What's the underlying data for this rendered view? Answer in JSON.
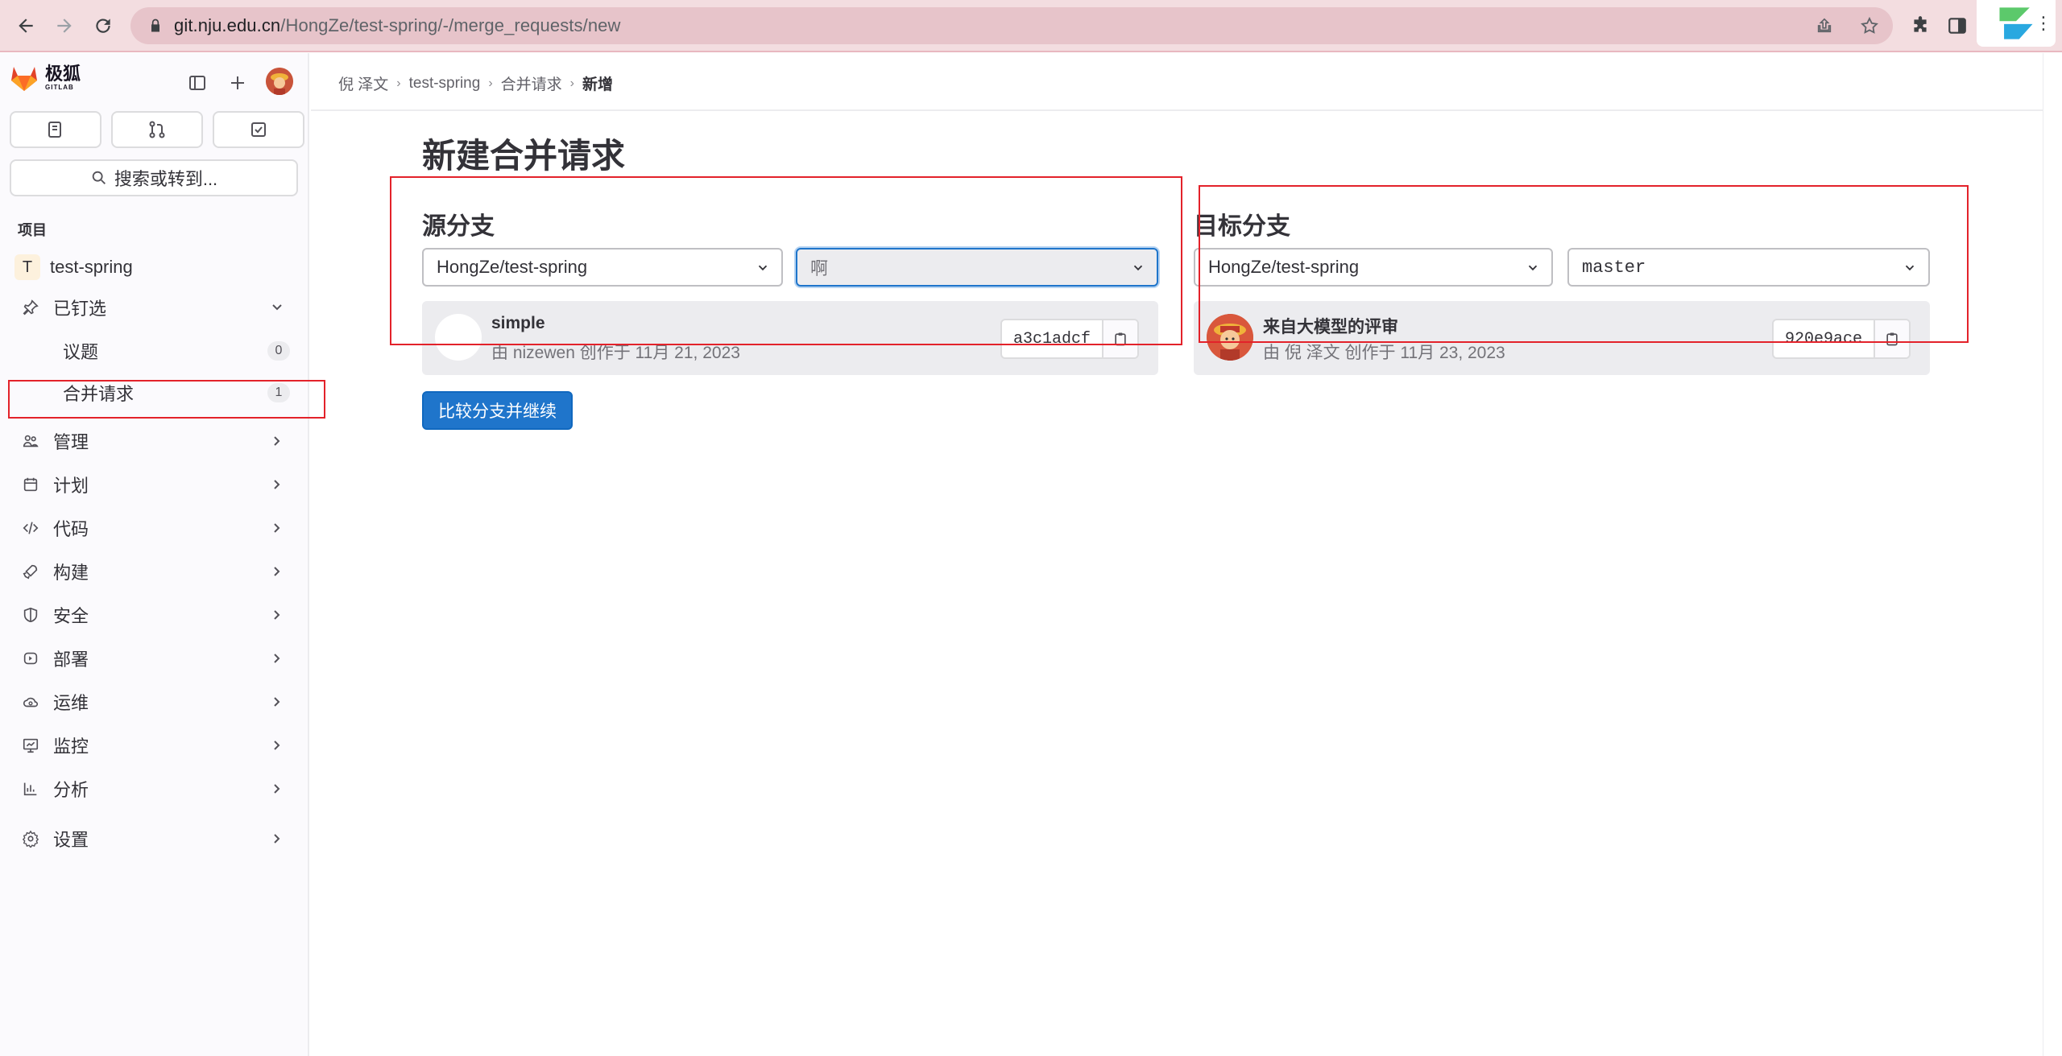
{
  "browser": {
    "url_host": "git.nju.edu.cn",
    "url_path": "/HongZe/test-spring/-/merge_requests/new"
  },
  "sidebar": {
    "logo_text": "极狐",
    "logo_subtext": "GITLAB",
    "search_placeholder": "搜索或转到...",
    "section_label": "项目",
    "project_initial": "T",
    "project_name": "test-spring",
    "pinned": {
      "label": "已钉选",
      "items": [
        {
          "label": "议题",
          "count": "0"
        },
        {
          "label": "合并请求",
          "count": "1"
        }
      ]
    },
    "nav": [
      {
        "label": "管理",
        "icon": "users-icon"
      },
      {
        "label": "计划",
        "icon": "calendar-icon"
      },
      {
        "label": "代码",
        "icon": "code-icon"
      },
      {
        "label": "构建",
        "icon": "rocket-icon"
      },
      {
        "label": "安全",
        "icon": "shield-icon"
      },
      {
        "label": "部署",
        "icon": "deploy-icon"
      },
      {
        "label": "运维",
        "icon": "cloud-gear-icon"
      },
      {
        "label": "监控",
        "icon": "monitor-icon"
      },
      {
        "label": "分析",
        "icon": "chart-icon"
      },
      {
        "label": "设置",
        "icon": "gear-icon"
      }
    ]
  },
  "breadcrumb": [
    "倪 泽文",
    "test-spring",
    "合并请求",
    "新增"
  ],
  "page": {
    "title": "新建合并请求",
    "source": {
      "title": "源分支",
      "project": "HongZe/test-spring",
      "branch": "啊",
      "commit_title": "simple",
      "commit_meta": "由 nizewen 创作于 11月 21, 2023",
      "sha": "a3c1adcf"
    },
    "target": {
      "title": "目标分支",
      "project": "HongZe/test-spring",
      "branch": "master",
      "commit_title": "来自大模型的评审",
      "commit_meta": "由 倪 泽文 创作于 11月 23, 2023",
      "sha": "920e9ace"
    },
    "compare_button": "比较分支并继续"
  },
  "colors": {
    "accent": "#1f75cb",
    "highlight": "#e3222a"
  }
}
